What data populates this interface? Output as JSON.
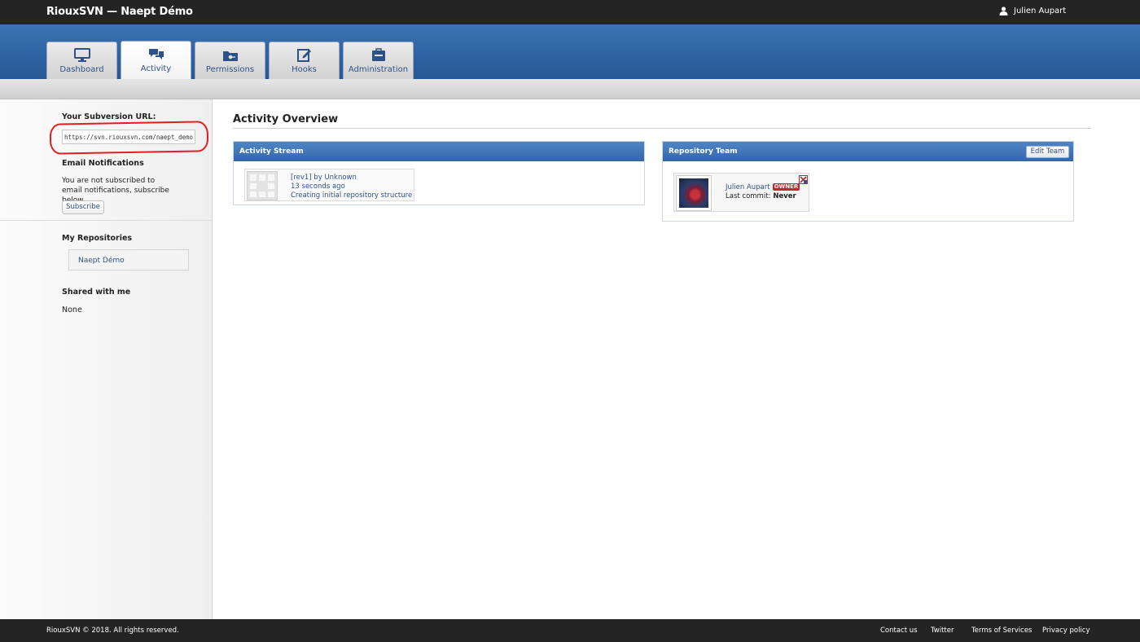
{
  "header": {
    "app_title": "RiouxSVN — Naept Démo",
    "user_name": "Julien Aupart",
    "user_icon": "user-icon"
  },
  "tabs": [
    {
      "label": "Dashboard",
      "icon": "monitor-icon",
      "active": false
    },
    {
      "label": "Activity",
      "icon": "chat-icon",
      "active": true
    },
    {
      "label": "Permissions",
      "icon": "folder-key-icon",
      "active": false
    },
    {
      "label": "Hooks",
      "icon": "edit-icon",
      "active": false
    },
    {
      "label": "Administration",
      "icon": "briefcase-icon",
      "active": false
    }
  ],
  "sidebar": {
    "svn_url_heading": "Your Subversion URL:",
    "svn_url": "https://svn.riouxsvn.com/naept_demo",
    "email_heading": "Email Notifications",
    "email_text": "You are not subscribed to email notifications, subscribe below.",
    "subscribe_label": "Subscribe",
    "my_repos_heading": "My Repositories",
    "repos": [
      "Naept Démo"
    ],
    "shared_heading": "Shared with me",
    "shared_value": "None"
  },
  "main": {
    "title": "Activity Overview",
    "activity_stream": {
      "title": "Activity Stream",
      "items": [
        {
          "line1": "[rev1] by Unknown",
          "line2": "13 seconds ago",
          "line3": "Creating initial repository structure"
        }
      ]
    },
    "repository_team": {
      "title": "Repository Team",
      "edit_label": "Edit Team",
      "members": [
        {
          "name": "Julien Aupart",
          "role": "OWNER",
          "last_commit_label": "Last commit:",
          "last_commit_value": "Never"
        }
      ]
    }
  },
  "footer": {
    "copyright": "RiouxSVN © 2018. All rights reserved.",
    "links": [
      "Contact us",
      "Twitter",
      "Terms of Services",
      "Privacy policy"
    ]
  },
  "colors": {
    "topbar": "#242424",
    "nav_blue": "#2d62a2",
    "link_blue": "#2c5289",
    "annotation_red": "#e02020",
    "owner_badge": "#c0282d"
  }
}
